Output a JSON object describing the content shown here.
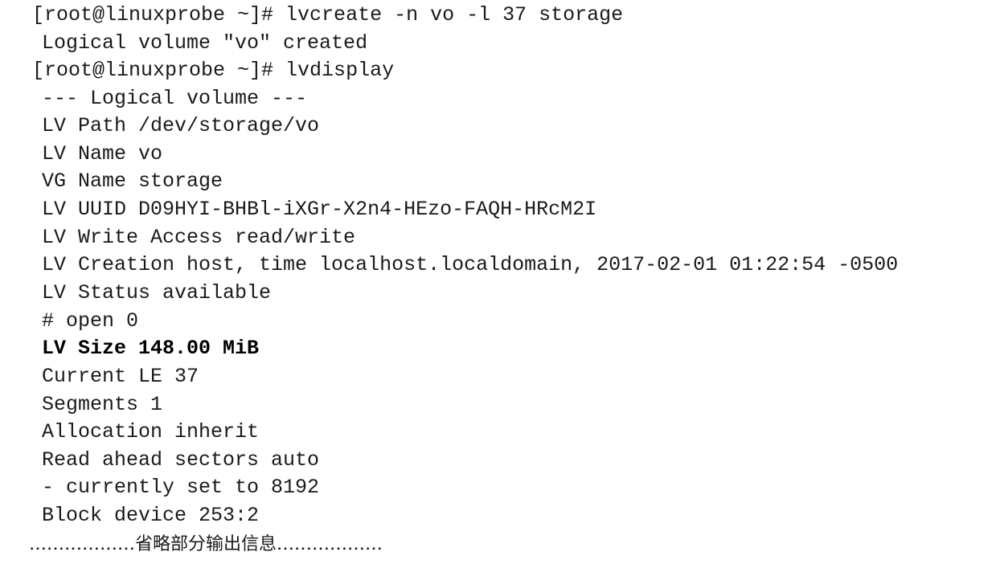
{
  "terminal": {
    "lines": [
      "[root@linuxprobe ~]# lvcreate -n vo -l 37 storage",
      "Logical volume \"vo\" created",
      "[root@linuxprobe ~]# lvdisplay",
      "--- Logical volume ---",
      "LV Path /dev/storage/vo",
      "LV Name vo",
      "VG Name storage",
      "LV UUID D09HYI-BHBl-iXGr-X2n4-HEzo-FAQH-HRcM2I",
      "LV Write Access read/write",
      "LV Creation host, time localhost.localdomain, 2017-02-01 01:22:54 -0500",
      "LV Status available",
      "# open 0",
      "LV Size 148.00 MiB",
      "Current LE 37",
      "Segments 1",
      "Allocation inherit",
      "Read ahead sectors auto",
      "- currently set to 8192",
      "Block device 253:2"
    ],
    "footer": "………………省略部分输出信息………………"
  }
}
